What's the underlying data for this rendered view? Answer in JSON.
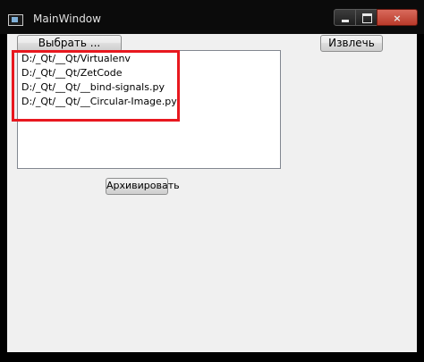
{
  "window": {
    "title": "MainWindow",
    "controls": {
      "minimize": "minimize",
      "maximize": "maximize",
      "close": "×"
    }
  },
  "toolbar": {
    "select_label": "Выбрать ...",
    "extract_label": "Извлечь"
  },
  "file_list": {
    "items": [
      "D:/_Qt/__Qt/Virtualenv",
      "D:/_Qt/__Qt/ZetCode",
      "D:/_Qt/__Qt/__bind-signals.py",
      "D:/_Qt/__Qt/__Circular-Image.py"
    ]
  },
  "actions": {
    "archive_label": "Архивировать"
  },
  "annotation": {
    "color": "#e8181f"
  }
}
